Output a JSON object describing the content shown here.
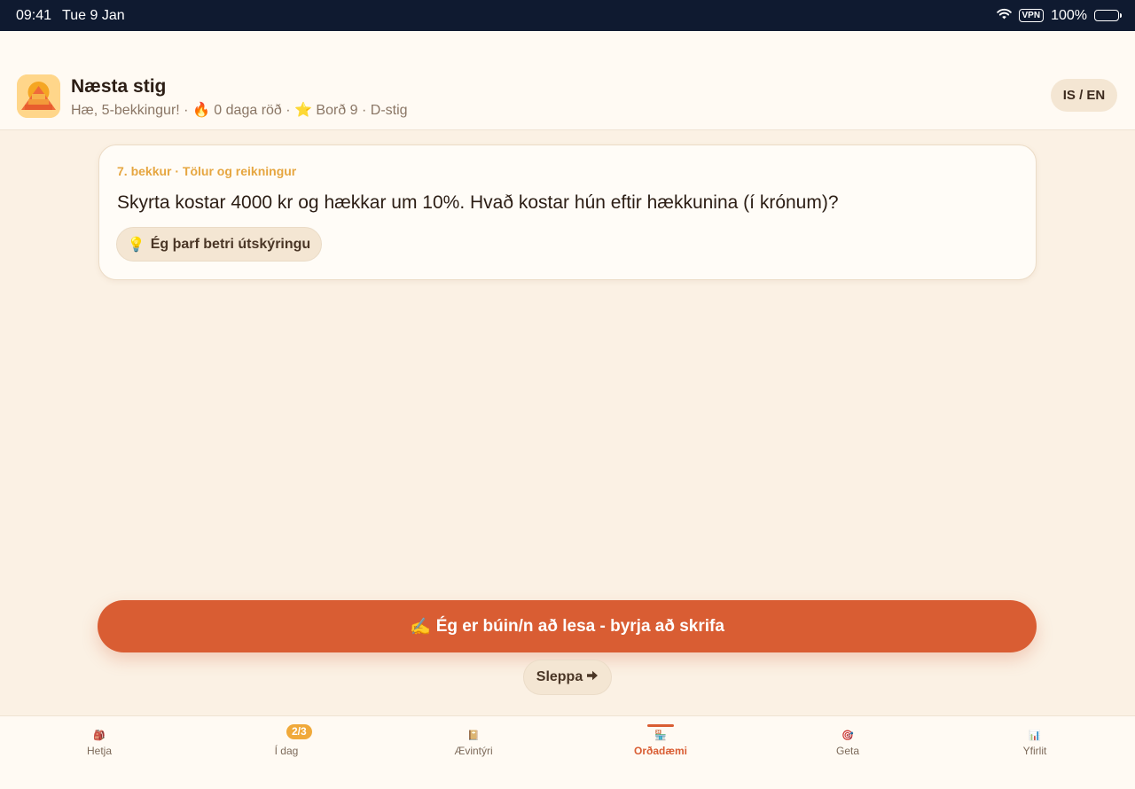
{
  "status_bar": {
    "time": "09:41",
    "date": "Tue 9 Jan",
    "vpn": "VPN",
    "battery": "100%",
    "icons": [
      "wifi-icon",
      "battery-icon"
    ]
  },
  "header": {
    "title": "Næsta stig",
    "subtitle": "Hæ, 5-bekkingur! · 🔥 0 daga röð · ⭐ Borð 9 · D-stig",
    "lang_toggle": "IS / EN"
  },
  "question": {
    "meta": "7. bekkur · Tölur og reikningur",
    "text": "Skyrta kostar 4000 kr og hækkar um 10%. Hvað kostar hún eftir hækkunina (í krónum)?",
    "hint_icon": "💡",
    "hint_label": "Ég þarf betri útskýringu"
  },
  "actions": {
    "primary_icon": "✍️",
    "primary_label": "Ég er búin/n að lesa - byrja að skrifa",
    "skip_label": "Sleppa",
    "skip_icon": "🡆"
  },
  "nav": {
    "items": [
      {
        "label": "Hetja",
        "icon": "🎒"
      },
      {
        "label": "Í dag",
        "icon": "",
        "badge": "2/3"
      },
      {
        "label": "Ævintýri",
        "icon": "📔"
      },
      {
        "label": "Orðadæmi",
        "icon": "🏪"
      },
      {
        "label": "Geta",
        "icon": "🎯"
      },
      {
        "label": "Yfirlit",
        "icon": "📊"
      }
    ],
    "active": "Orðadæmi"
  },
  "colors": {
    "accent": "#d95d33",
    "meta": "#e6a640",
    "background": "#fbf1e4",
    "statusbar": "#0f1a30"
  }
}
